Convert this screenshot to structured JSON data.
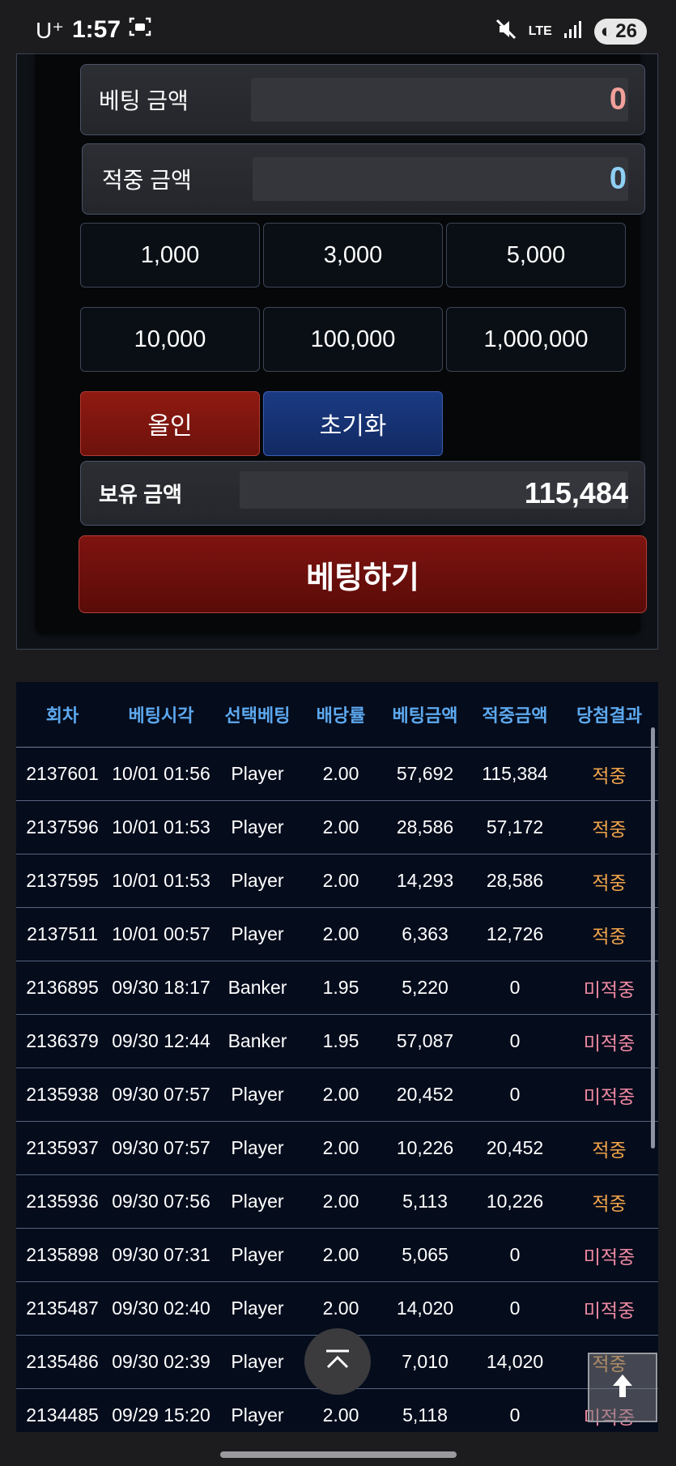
{
  "status": {
    "carrier": "U⁺",
    "time": "1:57",
    "network": "LTE",
    "battery": "26"
  },
  "bet_form": {
    "bet_amount_label": "베팅 금액",
    "bet_amount_value": "0",
    "win_amount_label": "적중 금액",
    "win_amount_value": "0",
    "amount_buttons": [
      "1,000",
      "3,000",
      "5,000",
      "10,000",
      "100,000",
      "1,000,000"
    ],
    "allin_label": "올인",
    "reset_label": "초기화",
    "balance_label": "보유 금액",
    "balance_value": "115,484",
    "submit_label": "베팅하기",
    "colors": {
      "bet_value": "#f2a09a",
      "win_value": "#8fd0f5"
    }
  },
  "history": {
    "headers": [
      "회차",
      "베팅시각",
      "선택베팅",
      "배당률",
      "베팅금액",
      "적중금액",
      "당첨결과"
    ],
    "rows": [
      [
        "2137601",
        "10/01 01:56",
        "Player",
        "2.00",
        "57,692",
        "115,384",
        "적중"
      ],
      [
        "2137596",
        "10/01 01:53",
        "Player",
        "2.00",
        "28,586",
        "57,172",
        "적중"
      ],
      [
        "2137595",
        "10/01 01:53",
        "Player",
        "2.00",
        "14,293",
        "28,586",
        "적중"
      ],
      [
        "2137511",
        "10/01 00:57",
        "Player",
        "2.00",
        "6,363",
        "12,726",
        "적중"
      ],
      [
        "2136895",
        "09/30 18:17",
        "Banker",
        "1.95",
        "5,220",
        "0",
        "미적중"
      ],
      [
        "2136379",
        "09/30 12:44",
        "Banker",
        "1.95",
        "57,087",
        "0",
        "미적중"
      ],
      [
        "2135938",
        "09/30 07:57",
        "Player",
        "2.00",
        "20,452",
        "0",
        "미적중"
      ],
      [
        "2135937",
        "09/30 07:57",
        "Player",
        "2.00",
        "10,226",
        "20,452",
        "적중"
      ],
      [
        "2135936",
        "09/30 07:56",
        "Player",
        "2.00",
        "5,113",
        "10,226",
        "적중"
      ],
      [
        "2135898",
        "09/30 07:31",
        "Player",
        "2.00",
        "5,065",
        "0",
        "미적중"
      ],
      [
        "2135487",
        "09/30 02:40",
        "Player",
        "2.00",
        "14,020",
        "0",
        "미적중"
      ],
      [
        "2135486",
        "09/30 02:39",
        "Player",
        "2.00",
        "7,010",
        "14,020",
        "적중"
      ],
      [
        "2134485",
        "09/29 15:20",
        "Player",
        "2.00",
        "5,118",
        "0",
        "미적중"
      ]
    ],
    "colors": {
      "hit": "#f0a44a",
      "miss": "#f08aa2",
      "header": "#5da9ef"
    }
  }
}
